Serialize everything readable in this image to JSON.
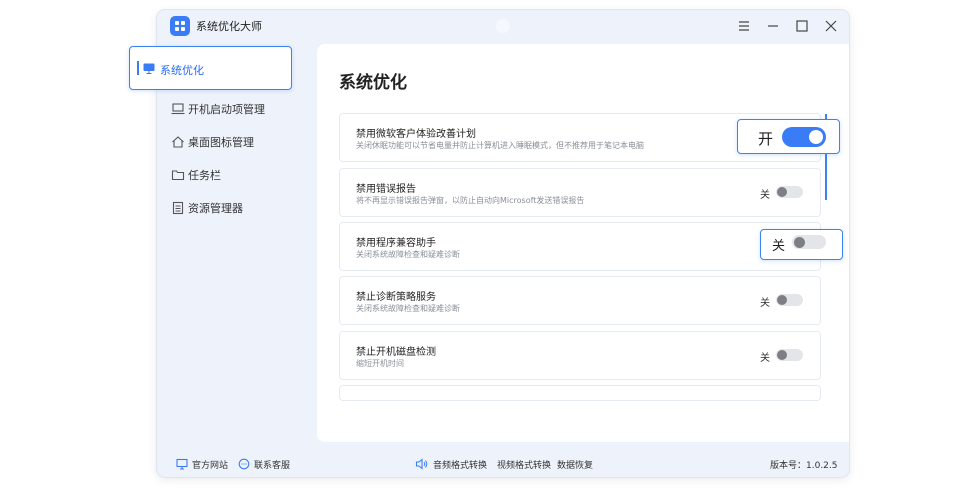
{
  "window": {
    "title": "系统优化大师"
  },
  "sidebar": {
    "items": [
      {
        "label": "系统优化",
        "icon": "monitor-icon",
        "selected": true
      },
      {
        "label": "开机启动项管理",
        "icon": "laptop-icon"
      },
      {
        "label": "桌面图标管理",
        "icon": "home-icon"
      },
      {
        "label": "任务栏",
        "icon": "folder-icon"
      },
      {
        "label": "资源管理器",
        "icon": "document-icon"
      }
    ]
  },
  "main": {
    "title": "系统优化",
    "settings": [
      {
        "title": "禁用微软客户体验改善计划",
        "desc": "关闭休眠功能可以节省电量并防止计算机进入睡眠模式，但不推荐用于笔记本电脑",
        "state": "开",
        "on": true
      },
      {
        "title": "禁用错误报告",
        "desc": "将不再显示错误报告弹窗，以防止自动向Microsoft发送错误报告",
        "state": "关",
        "on": false
      },
      {
        "title": "禁用程序兼容助手",
        "desc": "关闭系统故障检查和疑难诊断",
        "state": "关",
        "on": false
      },
      {
        "title": "禁止诊断策略服务",
        "desc": "关闭系统故障检查和疑难诊断",
        "state": "关",
        "on": false
      },
      {
        "title": "禁止开机磁盘检测",
        "desc": "缩短开机时间",
        "state": "关",
        "on": false
      }
    ]
  },
  "footer": {
    "website": "官方网站",
    "support": "联系客服",
    "audio": "音频格式转换",
    "video": "视频格式转换",
    "recovery": "数据恢复",
    "version": "版本号：1.0.2.5"
  },
  "colors": {
    "accent": "#3a7cf5",
    "window_bg": "#eef3fb"
  }
}
